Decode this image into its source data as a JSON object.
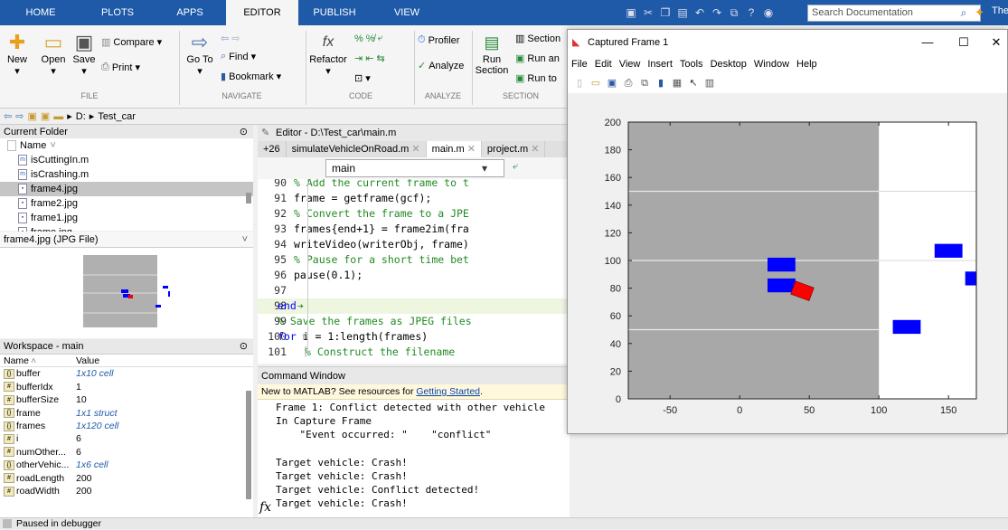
{
  "tabs": [
    "HOME",
    "PLOTS",
    "APPS",
    "EDITOR",
    "PUBLISH",
    "VIEW"
  ],
  "search": {
    "placeholder": "Search Documentation"
  },
  "header_right": "The",
  "toolstrip": {
    "new": "New",
    "open": "Open",
    "save": "Save",
    "compare": "Compare",
    "print": "Print",
    "goto": "Go To",
    "find": "Find",
    "bookmark": "Bookmark",
    "refactor": "Refactor",
    "profiler": "Profiler",
    "analyze": "Analyze",
    "run_section": "Run Section",
    "section": "Section",
    "run_an": "Run an",
    "run_to": "Run to",
    "groups": [
      "FILE",
      "NAVIGATE",
      "CODE",
      "ANALYZE",
      "SECTION"
    ]
  },
  "path": {
    "drive": "D:",
    "folder": "Test_car"
  },
  "current_folder": {
    "title": "Current Folder",
    "col_name": "Name",
    "files": [
      "isCuttingIn.m",
      "isCrashing.m",
      "frame4.jpg",
      "frame2.jpg",
      "frame1.jpg",
      "frame.jpg"
    ],
    "selected": "frame4.jpg"
  },
  "preview_title": "frame4.jpg (JPG File)",
  "workspace": {
    "title": "Workspace - main",
    "col_name": "Name",
    "col_value": "Value",
    "vars": [
      {
        "name": "buffer",
        "value": "1x10 cell",
        "italic": true
      },
      {
        "name": "bufferIdx",
        "value": "1",
        "italic": false
      },
      {
        "name": "bufferSize",
        "value": "10",
        "italic": false
      },
      {
        "name": "frame",
        "value": "1x1 struct",
        "italic": true
      },
      {
        "name": "frames",
        "value": "1x120 cell",
        "italic": true
      },
      {
        "name": "i",
        "value": "6",
        "italic": false
      },
      {
        "name": "numOther...",
        "value": "6",
        "italic": false
      },
      {
        "name": "otherVehic...",
        "value": "1x6 cell",
        "italic": true
      },
      {
        "name": "roadLength",
        "value": "200",
        "italic": false
      },
      {
        "name": "roadWidth",
        "value": "200",
        "italic": false
      }
    ]
  },
  "editor": {
    "title": "Editor - D:\\Test_car\\main.m",
    "tabs": [
      "+26",
      "simulateVehicleOnRoad.m",
      "main.m",
      "project.m"
    ],
    "function_selector": "main",
    "lines": [
      {
        "n": "90",
        "code": "% Add the current frame to t",
        "kind": "cm"
      },
      {
        "n": "91",
        "code": "frame = getframe(gcf);",
        "kind": "plain"
      },
      {
        "n": "92",
        "code": "% Convert the frame to a JPE",
        "kind": "cm"
      },
      {
        "n": "93",
        "code": "frames{end+1} = frame2im(fra",
        "kind": "plain"
      },
      {
        "n": "94",
        "code": "writeVideo(writerObj, frame)",
        "kind": "plain"
      },
      {
        "n": "95",
        "code": "% Pause for a short time bet",
        "kind": "cm"
      },
      {
        "n": "96",
        "code": "pause(0.1);",
        "kind": "plain"
      },
      {
        "n": "97",
        "code": "",
        "kind": "plain"
      },
      {
        "n": "98",
        "code": "end",
        "kind": "kw"
      },
      {
        "n": "99",
        "code": "% Save the frames as JPEG files",
        "kind": "cm"
      },
      {
        "n": "100",
        "code": "for i = 1:length(frames)",
        "kind": "kwfor"
      },
      {
        "n": "101",
        "code": "% Construct the filename",
        "kind": "cm"
      }
    ]
  },
  "command_window": {
    "title": "Command Window",
    "info_prefix": "New to MATLAB? See resources for ",
    "info_link": "Getting Started",
    "info_suffix": ".",
    "lines": [
      "Frame 1: Conflict detected with other vehicle",
      "In Capture Frame",
      "    \"Event occurred: \"    \"conflict\"",
      "",
      "Target vehicle: Crash!",
      "Target vehicle: Crash!",
      "Target vehicle: Conflict detected!",
      "Target vehicle: Crash!"
    ],
    "prompt_symbol": "fx"
  },
  "status": "Paused in debugger",
  "figure": {
    "title": "Captured Frame 1",
    "menu": [
      "File",
      "Edit",
      "View",
      "Insert",
      "Tools",
      "Desktop",
      "Window",
      "Help"
    ],
    "colors": {
      "road": "#a8a8a8",
      "vehicle": "#0000ff",
      "target": "#ff0000",
      "lane": "#e8e8e8"
    }
  },
  "chart_data": {
    "type": "scatter",
    "title": "",
    "xlabel": "",
    "ylabel": "",
    "xlim": [
      -80,
      170
    ],
    "ylim": [
      0,
      200
    ],
    "xticks": [
      -50,
      0,
      50,
      100,
      150
    ],
    "yticks": [
      0,
      20,
      40,
      60,
      80,
      100,
      120,
      140,
      160,
      180,
      200
    ],
    "road": {
      "x_from": -80,
      "x_to": 100,
      "lane_lines_y": [
        50,
        100,
        150
      ],
      "offroad_lines_y": [
        100,
        150
      ]
    },
    "other_vehicles": [
      {
        "x": 30,
        "y": 97,
        "w": 20,
        "h": 10
      },
      {
        "x": 30,
        "y": 82,
        "w": 20,
        "h": 10
      },
      {
        "x": 150,
        "y": 107,
        "w": 20,
        "h": 10
      },
      {
        "x": 120,
        "y": 52,
        "w": 20,
        "h": 10
      },
      {
        "x": 172,
        "y": 87,
        "w": 20,
        "h": 10
      }
    ],
    "target_vehicle": {
      "x": 45,
      "y": 78,
      "w": 14,
      "h": 10,
      "angle": 20
    }
  }
}
